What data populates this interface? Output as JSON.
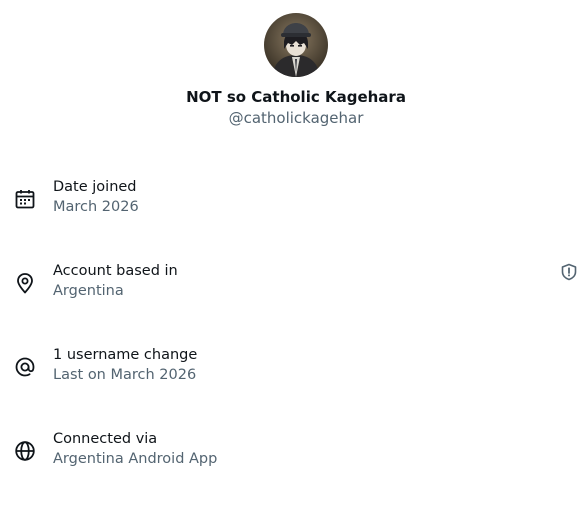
{
  "profile": {
    "display_name": "NOT so Catholic Kagehara",
    "handle": "@catholickagehar",
    "avatar_icon": "avatar-image"
  },
  "info_rows": [
    {
      "icon": "calendar-icon",
      "title": "Date joined",
      "value": "March 2026"
    },
    {
      "icon": "location-pin-icon",
      "title": "Account based in",
      "value": "Argentina",
      "badge_icon": "shield-icon"
    },
    {
      "icon": "at-sign-icon",
      "title": "1 username change",
      "value": "Last on March 2026"
    },
    {
      "icon": "globe-icon",
      "title": "Connected via",
      "value": "Argentina Android App"
    }
  ],
  "colors": {
    "primary_text": "#0f1419",
    "secondary_text": "#536471"
  }
}
